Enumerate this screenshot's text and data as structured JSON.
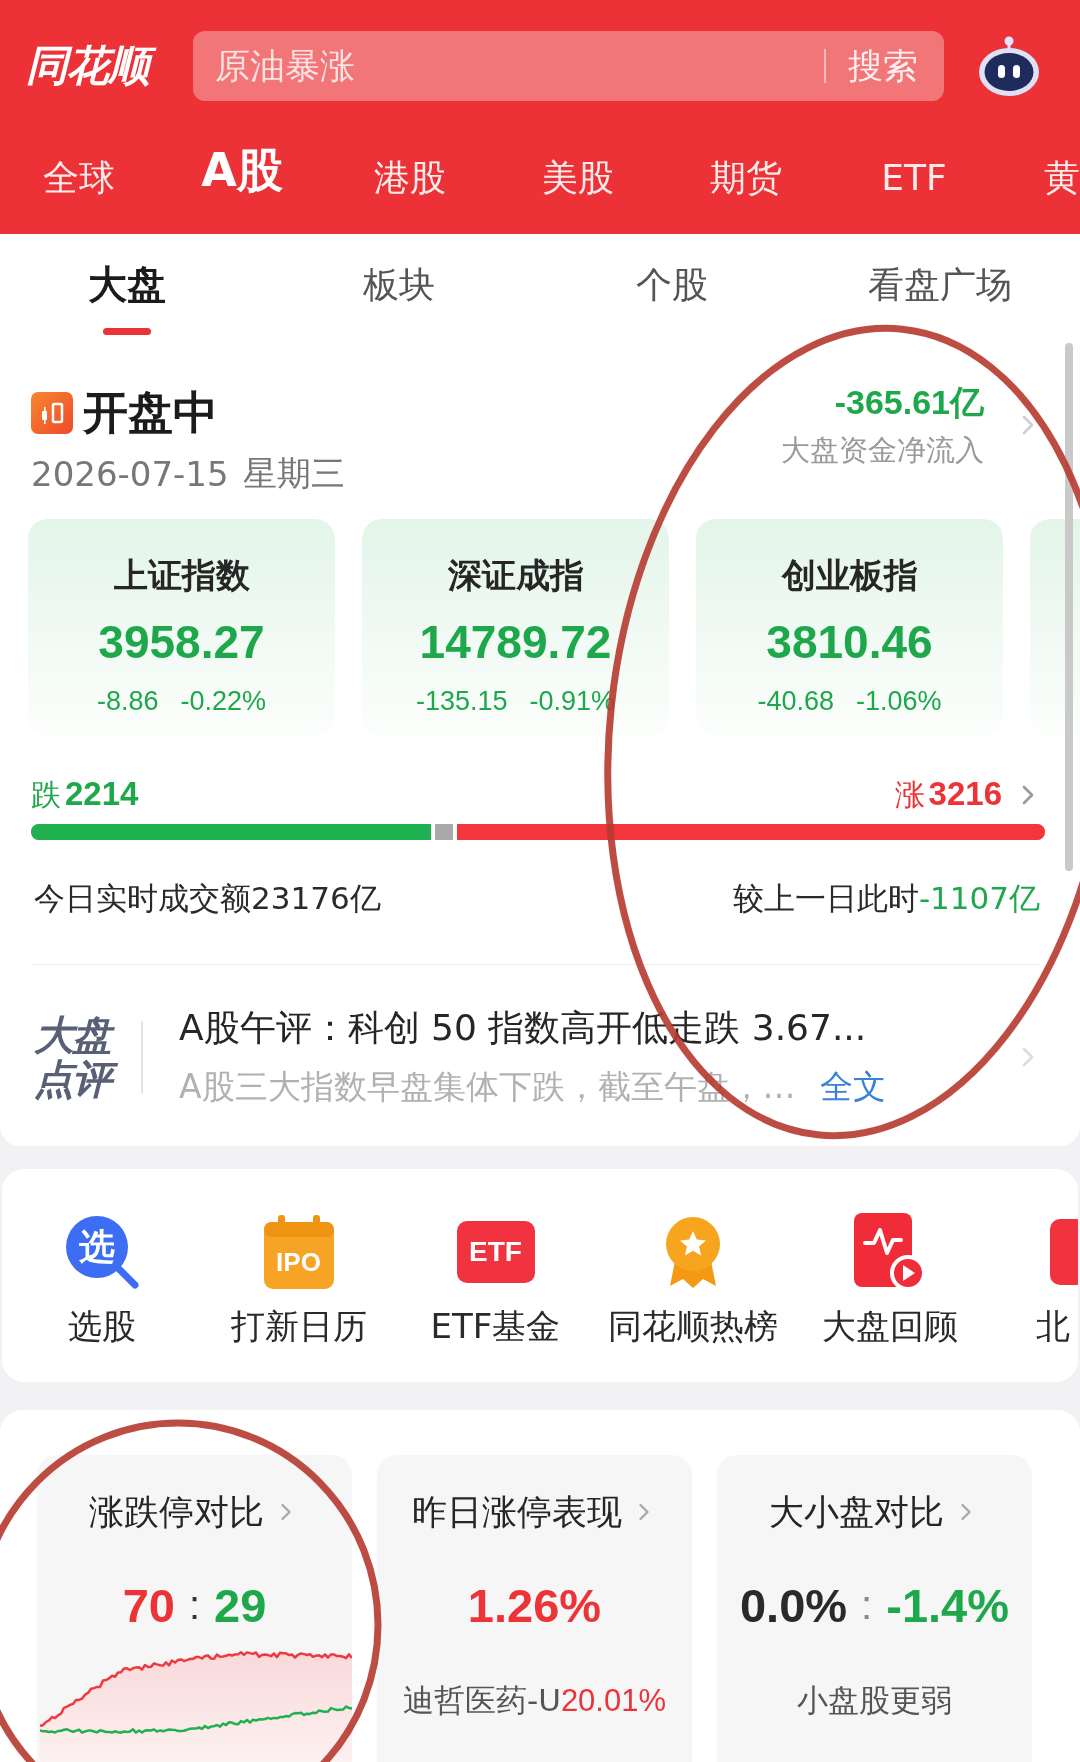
{
  "header": {
    "logo": "同花顺",
    "search": {
      "placeholder": "原油暴涨",
      "button": "搜索"
    }
  },
  "market_tabs": [
    {
      "label": "全球",
      "selected": false
    },
    {
      "label": "A股",
      "selected": true
    },
    {
      "label": "港股",
      "selected": false
    },
    {
      "label": "美股",
      "selected": false
    },
    {
      "label": "期货",
      "selected": false
    },
    {
      "label": "ETF",
      "selected": false
    },
    {
      "label": "黄",
      "selected": false
    }
  ],
  "sub_tabs": [
    {
      "label": "大盘",
      "selected": true
    },
    {
      "label": "板块",
      "selected": false
    },
    {
      "label": "个股",
      "selected": false
    },
    {
      "label": "看盘广场",
      "selected": false
    }
  ],
  "session": {
    "status": "开盘中",
    "date": "2026-07-15",
    "weekday": "星期三",
    "net_flow": {
      "value": "-365.61亿",
      "label": "大盘资金净流入",
      "falling": true,
      "circled": true
    }
  },
  "indices": [
    {
      "name": "上证指数",
      "value": "3958.27",
      "change": "-8.86",
      "change_pct": "-0.22%",
      "falling": true
    },
    {
      "name": "深证成指",
      "value": "14789.72",
      "change": "-135.15",
      "change_pct": "-0.91%",
      "falling": true
    },
    {
      "name": "创业板指",
      "value": "3810.46",
      "change": "-40.68",
      "change_pct": "-1.06%",
      "falling": true
    }
  ],
  "more_indices_peek": true,
  "breadth": {
    "down": {
      "label": "跌",
      "count": "2214"
    },
    "up": {
      "label": "涨",
      "count": "3216"
    },
    "fills": [
      {
        "kind": "down",
        "level": 0.398
      },
      {
        "kind": "up",
        "level": 0.584
      }
    ]
  },
  "turnover": {
    "text": "今日实时成交额23176亿",
    "compare_label": "较上一日此时",
    "compare_value": "-1107亿",
    "compare_falling": true
  },
  "commentary": {
    "logo": "大盘点评",
    "headline": "A股午评：科创 50 指数高开低走跌 3.67...",
    "summary": "A股三大指数早盘集体下跌，截至午盘，…",
    "link": "全文"
  },
  "tools": [
    {
      "kind": "pick",
      "glyph": "选",
      "label": "选股"
    },
    {
      "kind": "calendar",
      "glyph": "IPO",
      "label": "打新日历"
    },
    {
      "kind": "badge",
      "glyph": "ETF",
      "label": "ETF基金"
    },
    {
      "kind": "medal",
      "label": "同花顺热榜"
    },
    {
      "kind": "replay",
      "label": "大盘回顾"
    },
    {
      "kind": "partial",
      "label": "北"
    }
  ],
  "stat_cards": [
    {
      "kind": "chart",
      "title": "涨跌停对比",
      "circled": true,
      "value_parts": [
        {
          "text": "70",
          "color": "#ec3338"
        },
        {
          "text": ":",
          "color": "#333333"
        },
        {
          "text": "29",
          "color": "#1fa74b"
        }
      ]
    },
    {
      "kind": "stock",
      "title": "昨日涨停表现",
      "circled": false,
      "value_parts": [
        {
          "text": "1.26%",
          "color": "#ec3338"
        }
      ],
      "stock": "迪哲医药-U",
      "stock_change": "20.01%"
    },
    {
      "kind": "caption",
      "title": "大小盘对比",
      "circled": false,
      "value_parts": [
        {
          "text": "0.0%",
          "color": "#2a2a2a"
        },
        {
          "text": ":",
          "color": "#888888"
        },
        {
          "text": "-1.4%",
          "color": "#1fa74b"
        }
      ],
      "caption": "小盘股更弱"
    }
  ]
}
